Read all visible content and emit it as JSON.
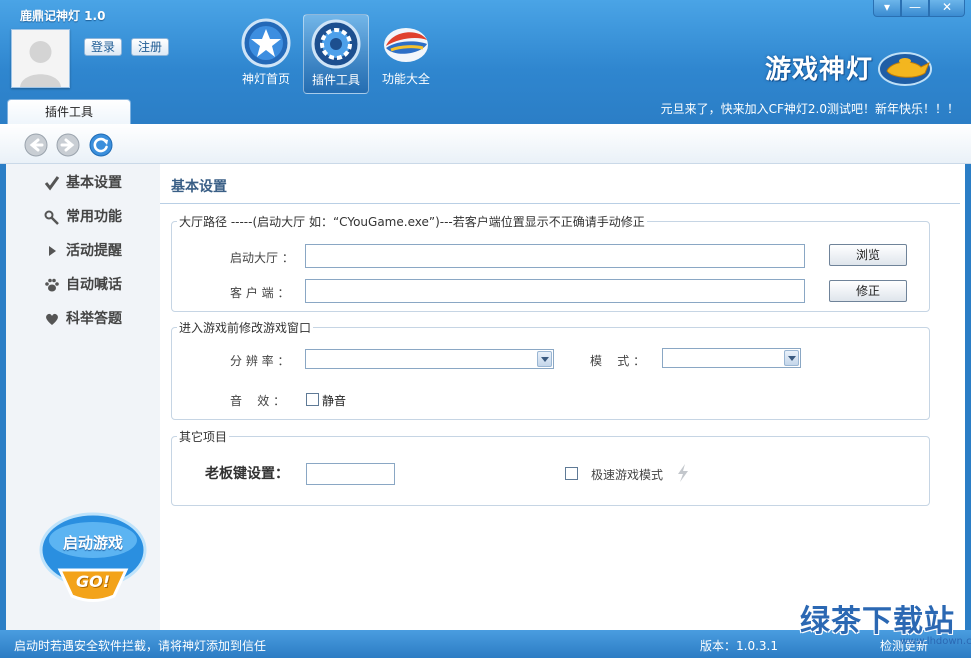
{
  "window": {
    "title": "鹿鼎记神灯  1.0",
    "menu_glyph": "▾",
    "min_glyph": "—",
    "close_glyph": "✕"
  },
  "header": {
    "login_label": "登录",
    "register_label": "注册",
    "nav": [
      {
        "label": "神灯首页",
        "icon": "star-icon"
      },
      {
        "label": "插件工具",
        "icon": "gear-icon"
      },
      {
        "label": "功能大全",
        "icon": "book-icon"
      }
    ],
    "active_nav": 1,
    "logo_text": "游戏神灯",
    "marquee": "元旦来了，快来加入CF神灯2.0测试吧！新年快乐！！！"
  },
  "page_tab": "插件工具",
  "toolbar": {
    "icons": [
      "back-arrow-icon",
      "forward-arrow-icon",
      "refresh-icon"
    ]
  },
  "sidebar": {
    "items": [
      {
        "label": "基本设置",
        "icon": "check-icon"
      },
      {
        "label": "常用功能",
        "icon": "key-icon"
      },
      {
        "label": "活动提醒",
        "icon": "triangle-icon"
      },
      {
        "label": "自动喊话",
        "icon": "paw-icon"
      },
      {
        "label": "科举答题",
        "icon": "heart-icon"
      }
    ],
    "start_button": {
      "line1": "启动游戏",
      "line2": "GO!"
    }
  },
  "main": {
    "title": "基本设置",
    "group1": {
      "legend": "大厅路径  -----(启动大厅 如：“CYouGame.exe”)---若客户端位置显示不正确请手动修正",
      "lobby_label": "启动大厅 ：",
      "lobby_value": "",
      "browse_label": "浏览",
      "client_label": "客 户 端 ：",
      "client_value": "",
      "fix_label": "修正"
    },
    "group2": {
      "legend": "进入游戏前修改游戏窗口",
      "resolution_label": "分 辨 率 ：",
      "resolution_value": "",
      "mode_label": "模    式 ：",
      "mode_value": "",
      "sound_label": "音    效 ：",
      "mute_label": "静音",
      "mute_checked": false
    },
    "group3": {
      "legend": "其它项目",
      "bosskey_label": "老板键设置：",
      "bosskey_value": "",
      "fastmode_label": "极速游戏模式",
      "fastmode_checked": false
    }
  },
  "statusbar": {
    "left": "启动时若遇安全软件拦截，请将神灯添加到信任",
    "version": "版本：1.0.3.1",
    "update": "检测更新"
  },
  "watermark": {
    "text": "绿茶下载站",
    "url": "www.lhdown.com"
  },
  "colors": {
    "accent": "#2f86cf",
    "title_blue": "#3a5f86",
    "sidebar_bg": "#f1f4f8"
  }
}
